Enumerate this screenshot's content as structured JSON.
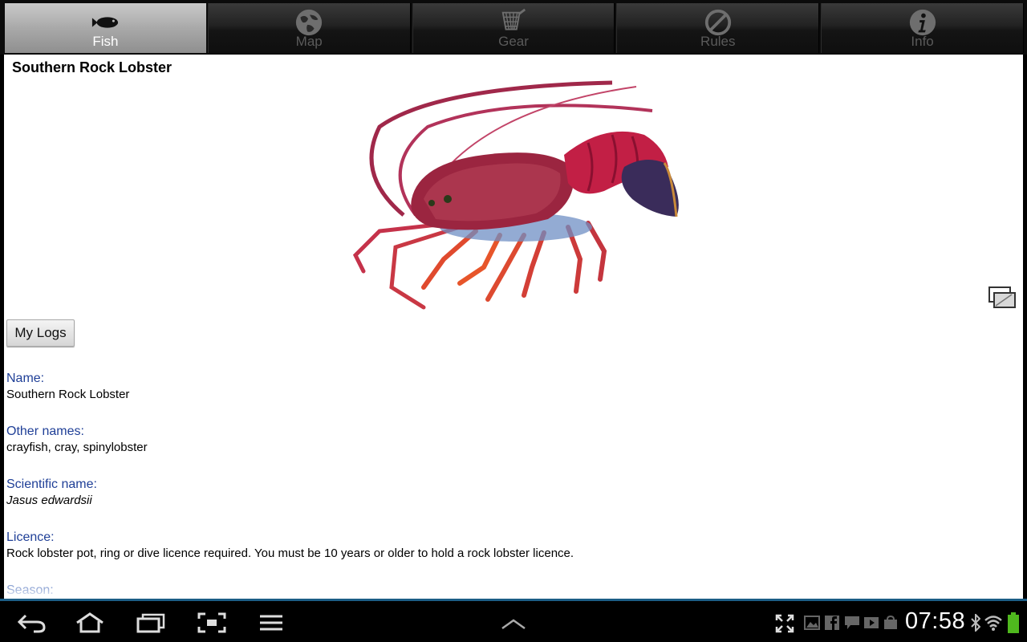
{
  "tabs": [
    {
      "label": "Fish",
      "icon": "fish-icon",
      "active": true
    },
    {
      "label": "Map",
      "icon": "globe-icon",
      "active": false
    },
    {
      "label": "Gear",
      "icon": "net-icon",
      "active": false
    },
    {
      "label": "Rules",
      "icon": "no-entry-icon",
      "active": false
    },
    {
      "label": "Info",
      "icon": "info-icon",
      "active": false
    }
  ],
  "page": {
    "title": "Southern Rock Lobster",
    "image": "lobster-illustration",
    "my_logs_button": "My Logs"
  },
  "fields": [
    {
      "label": "Name:",
      "value": "Southern Rock Lobster"
    },
    {
      "label": "Other names:",
      "value": "crayfish, cray, spinylobster"
    },
    {
      "label": "Scientific name:",
      "value": "Jasus edwardsii",
      "italic": true
    },
    {
      "label": "Licence:",
      "value": "Rock lobster pot, ring or dive licence required. You must be 10 years or older to hold a rock lobster licence."
    },
    {
      "label": "Season:",
      "value": ""
    }
  ],
  "status_bar": {
    "time": "07:58"
  },
  "colors": {
    "field_label": "#1f3f97",
    "system_bar_accent": "#1c5e86",
    "active_tab": "#a9a9a9"
  }
}
